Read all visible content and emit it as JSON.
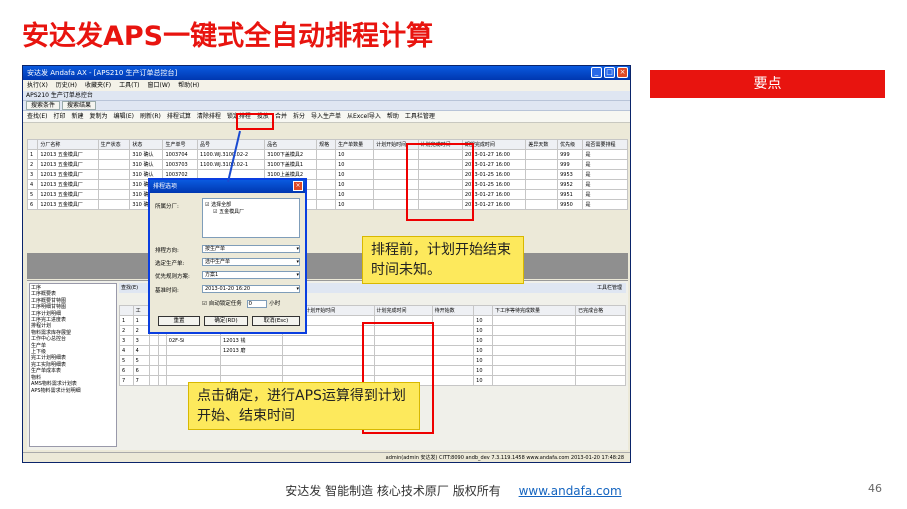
{
  "slide": {
    "title": "安达发APS一键式全自动排程计算",
    "keypoint": "要点",
    "footer": "安达发 智能制造 核心技术原厂 版权所有",
    "link": "www.andafa.com",
    "page": "46"
  },
  "window": {
    "title": "安达发 Andafa AX - [APS210 生产订单总控台]",
    "menus": [
      "执行(X)",
      "历史(H)",
      "收藏夹(F)",
      "工具(T)",
      "窗口(W)",
      "帮助(H)"
    ],
    "subtitle": "APS210 生产订单总控台",
    "tabs": [
      "搜索条件",
      "搜索结果"
    ],
    "toolbar": [
      "查找(E)",
      "打印",
      "新建",
      "复制为",
      "编辑(E)",
      "刷新(R)",
      "排程试算",
      "清除排程",
      "锁定排程",
      "投放",
      "合并",
      "拆分",
      "导入生产单",
      "从Excel导入",
      "帮助",
      "工具栏管理"
    ],
    "columns": [
      "",
      "分厂名称",
      "生产状态",
      "状态",
      "生产单号",
      "品号",
      "品名",
      "规格",
      "生产单数量",
      "计划开始时间",
      "计划完成时间",
      "期望完成时间",
      "差异天数",
      "优先级",
      "是否需要排程"
    ],
    "rows": [
      [
        "1",
        "12013 五金模具厂",
        "",
        "310 确认",
        "1003704",
        "1100.WJ.3100.02-2",
        "3100下盖模具2",
        "",
        "10",
        "",
        "",
        "2013-01-27 16:00",
        "",
        "999",
        "是"
      ],
      [
        "2",
        "12013 五金模具厂",
        "",
        "310 确认",
        "1003703",
        "1100.WJ.3100.02-1",
        "3100下盖模具1",
        "",
        "10",
        "",
        "",
        "2013-01-27 16:00",
        "",
        "999",
        "是"
      ],
      [
        "3",
        "12013 五金模具厂",
        "",
        "310 确认",
        "1003702",
        "",
        "3100上盖模具2",
        "",
        "10",
        "",
        "",
        "2013-01-25 16:00",
        "",
        "9953",
        "是"
      ],
      [
        "4",
        "12013 五金模具厂",
        "",
        "310 确认",
        "",
        "",
        "3100上盖模具1",
        "",
        "10",
        "",
        "",
        "2013-01-25 16:00",
        "",
        "9952",
        "是"
      ],
      [
        "5",
        "12013 五金模具厂",
        "",
        "310 确认",
        "",
        "",
        "",
        "",
        "10",
        "",
        "",
        "2013-01-27 16:00",
        "",
        "9951",
        "是"
      ],
      [
        "6",
        "12013 五金模具厂",
        "",
        "310 确认",
        "",
        "",
        "",
        "",
        "10",
        "",
        "",
        "2013-01-27 16:00",
        "",
        "9950",
        "是"
      ]
    ],
    "tree": [
      "工序",
      "工序概要表",
      "工序概要甘特图",
      "工序明细甘特图",
      "工序计划明细",
      "工序完工进度表",
      "排程计划",
      "物料需求库存展望",
      "工作中心总控台",
      "生产单",
      "上下级",
      "完工计划明细表",
      "完工实际明细表",
      "生产单成本表",
      "物料",
      "AMS物料需求计划表",
      "APS物料需求计划明细"
    ],
    "lower_toolbar": [
      "查找(E)",
      "工具栏管理"
    ],
    "columns2": [
      "",
      "工",
      "",
      "",
      "",
      "工艺名称",
      "工序排程计划开始时间",
      "计划完成时间",
      "待开始数",
      "",
      "下工序等待完成数量",
      "已完成合格"
    ],
    "rows2": [
      [
        "1",
        "1",
        "",
        "",
        "",
        "12013 穆密胜",
        "",
        "",
        "",
        "10",
        "",
        ""
      ],
      [
        "2",
        "2",
        "",
        "",
        "07.WKF-CK",
        "12013 车",
        "",
        "",
        "",
        "10",
        "",
        ""
      ],
      [
        "3",
        "3",
        "",
        "",
        "02F-Si",
        "12013 钱",
        "",
        "",
        "",
        "10",
        "",
        ""
      ],
      [
        "4",
        "4",
        "",
        "",
        "",
        "12013 磨",
        "",
        "",
        "",
        "10",
        "",
        ""
      ],
      [
        "5",
        "5",
        "",
        "",
        "",
        "",
        "",
        "",
        "",
        "10",
        "",
        ""
      ],
      [
        "6",
        "6",
        "",
        "",
        "",
        "",
        "",
        "",
        "",
        "10",
        "",
        ""
      ],
      [
        "7",
        "7",
        "",
        "",
        "",
        "",
        "",
        "",
        "",
        "10",
        "",
        ""
      ]
    ],
    "status": "admin(admin 安达发)  CITT:8090  andb_dev  7.3.119.1458  www.andafa.com  2013-01-20 17:48:28"
  },
  "dialog": {
    "title": "排程选项",
    "factory_label": "所属分厂:",
    "tree_all": "选择全部",
    "tree_item": "五金模具厂",
    "direction_label": "排程方向:",
    "direction": "按生产单",
    "select_label": "选定生产单:",
    "select": "选中生产单",
    "priority_label": "优先规则方案:",
    "priority": "方案1",
    "base_label": "基准时间:",
    "base": "2013-01-20 16:20",
    "lock_label": "自动锁定任务",
    "lock_value": "0",
    "lock_unit": "小时",
    "reset": "重置",
    "ok": "确定(RD)",
    "cancel": "取消(Esc)"
  },
  "callouts": {
    "before": "排程前，计划开始结束时间未知。",
    "after": "点击确定，进行APS运算得到计划开始、结束时间"
  }
}
